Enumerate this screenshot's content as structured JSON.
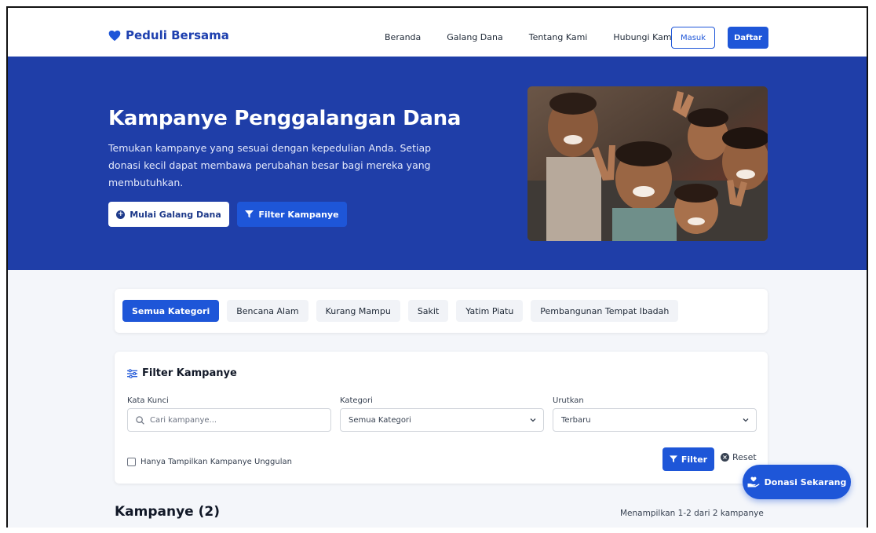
{
  "brand": {
    "name": "Peduli Bersama"
  },
  "nav": {
    "links": [
      "Beranda",
      "Galang Dana",
      "Tentang Kami",
      "Hubungi Kami"
    ],
    "login_label": "Masuk",
    "register_label": "Daftar"
  },
  "hero": {
    "title": "Kampanye Penggalangan Dana",
    "description": "Temukan kampanye yang sesuai dengan kepedulian Anda. Setiap donasi kecil dapat membawa perubahan besar bagi mereka yang membutuhkan.",
    "start_button": "Mulai Galang Dana",
    "filter_button": "Filter Kampanye"
  },
  "categories": {
    "items": [
      "Semua Kategori",
      "Bencana Alam",
      "Kurang Mampu",
      "Sakit",
      "Yatim Piatu",
      "Pembangunan Tempat Ibadah"
    ],
    "active_index": 0
  },
  "filter": {
    "title": "Filter Kampanye",
    "keyword_label": "Kata Kunci",
    "keyword_placeholder": "Cari kampanye...",
    "category_label": "Kategori",
    "category_value": "Semua Kategori",
    "sort_label": "Urutkan",
    "sort_value": "Terbaru",
    "featured_only_label": "Hanya Tampilkan Kampanye Unggulan",
    "filter_button": "Filter",
    "reset_button": "Reset"
  },
  "results": {
    "title": "Kampanye (2)",
    "count_text": "Menampilkan 1-2 dari 2 kampanye"
  },
  "floating": {
    "donate_label": "Donasi Sekarang"
  },
  "colors": {
    "primary": "#1e56d8",
    "hero_bg": "#1f3ea8",
    "page_bg": "#f4f6fa"
  }
}
